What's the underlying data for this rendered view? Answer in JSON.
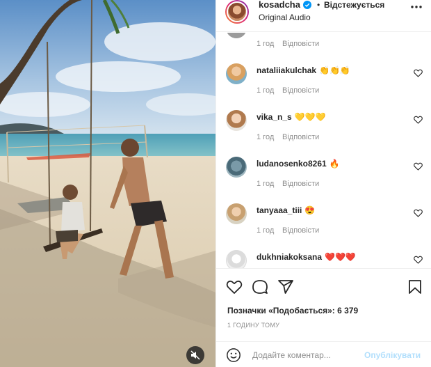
{
  "header": {
    "username": "kosadcha",
    "separator": "•",
    "follow_label": "Відстежується",
    "audio_label": "Original Audio",
    "verified_icon": "verified-badge-icon",
    "more_icon": "more-options-icon"
  },
  "comments": [
    {
      "username": "",
      "text": "",
      "time": "1 год",
      "reply_label": "Відповісти"
    },
    {
      "username": "nataliiakulchak",
      "text": "👏👏👏",
      "time": "1 год",
      "reply_label": "Відповісти"
    },
    {
      "username": "vika_n_s",
      "text": "💛💛💛",
      "time": "1 год",
      "reply_label": "Відповісти"
    },
    {
      "username": "ludanosenko8261",
      "text": "🔥",
      "time": "1 год",
      "reply_label": "Відповісти"
    },
    {
      "username": "tanyaaa_tiii",
      "text": "😍",
      "time": "1 год",
      "reply_label": "Відповісти"
    },
    {
      "username": "dukhniakoksana",
      "text": "❤️❤️❤️",
      "time": "",
      "reply_label": ""
    }
  ],
  "actions": {
    "icons": [
      "heart-icon",
      "comment-icon",
      "share-icon",
      "bookmark-icon"
    ],
    "likes_text": "Позначки «Подобається»: 6 379",
    "timestamp": "1 ГОДИНУ ТОМУ"
  },
  "comment_input": {
    "placeholder": "Додайте коментар...",
    "publish_label": "Опублікувати"
  },
  "media": {
    "mute_icon": "muted-speaker-icon"
  },
  "colors": {
    "accent": "#0095f6",
    "publish_disabled": "#b2dffc",
    "muted_text": "#8e8e8e"
  }
}
